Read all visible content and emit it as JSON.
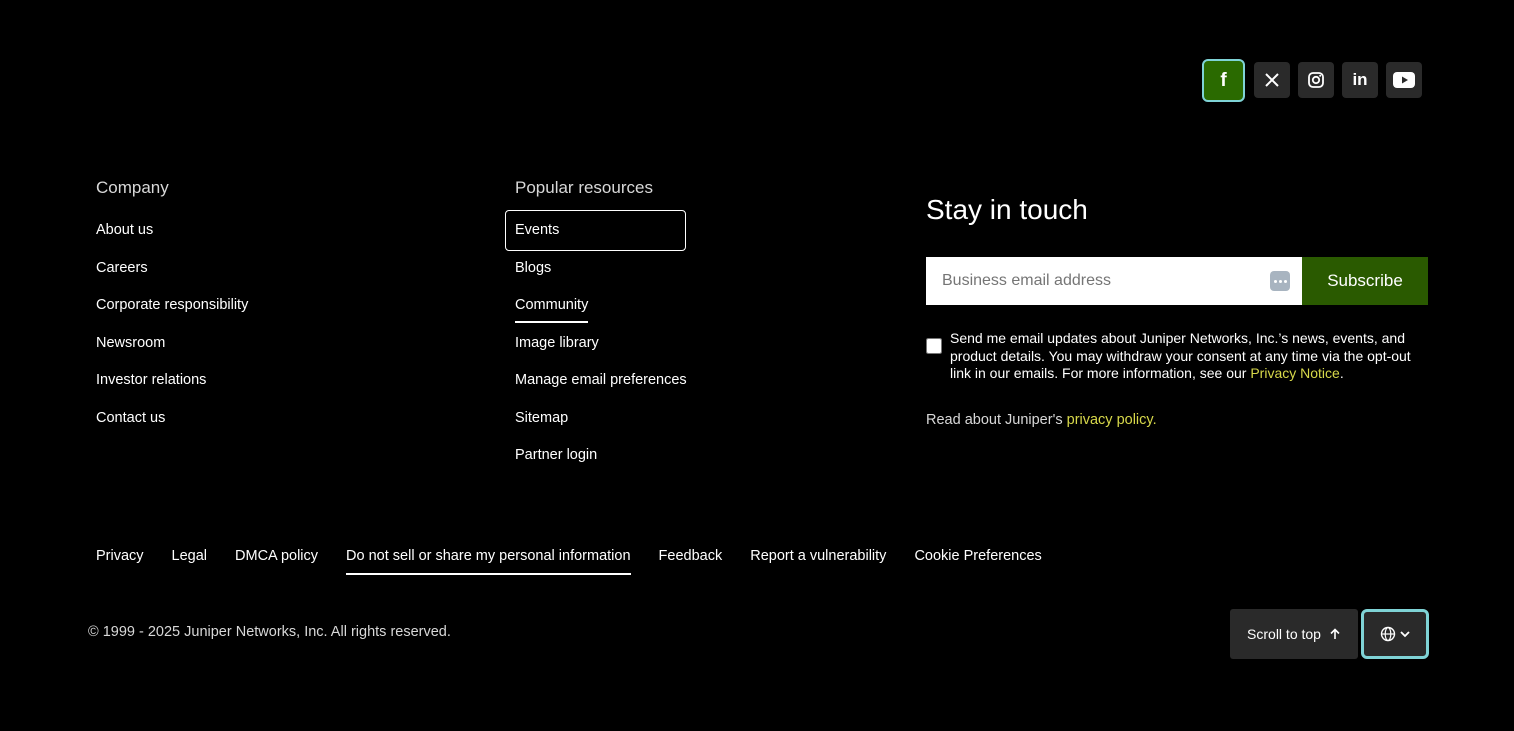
{
  "social": {
    "items": [
      {
        "name": "facebook",
        "glyph": "f"
      },
      {
        "name": "x"
      },
      {
        "name": "instagram"
      },
      {
        "name": "linkedin",
        "glyph": "in"
      },
      {
        "name": "youtube"
      }
    ]
  },
  "company": {
    "heading": "Company",
    "links": [
      "About us",
      "Careers",
      "Corporate responsibility",
      "Newsroom",
      "Investor relations",
      "Contact us"
    ]
  },
  "resources": {
    "heading": "Popular resources",
    "links": [
      "Events",
      "Blogs",
      "Community",
      "Image library",
      "Manage email preferences",
      "Sitemap",
      "Partner login"
    ]
  },
  "stay": {
    "heading": "Stay in touch",
    "email_placeholder": "Business email address",
    "subscribe_label": "Subscribe",
    "consent_text": "Send me email updates about Juniper Networks, Inc.’s news, events, and product details. You may withdraw your consent at any time via the opt-out link in our emails.  For more information, see our ",
    "consent_link": "Privacy Notice",
    "consent_end": ".",
    "privacy_read_text": "Read about Juniper's ",
    "privacy_read_link": "privacy policy."
  },
  "legal": {
    "links": [
      "Privacy",
      "Legal",
      "DMCA policy",
      "Do not sell or share my personal information",
      "Feedback",
      "Report a vulnerability",
      "Cookie Preferences"
    ]
  },
  "copyright": "© 1999 - 2025 Juniper Networks, Inc. All rights reserved.",
  "scroll_top_label": "Scroll to top",
  "colors": {
    "accent_green": "#2a5a00",
    "link_yellow": "#d7d84a",
    "focus_cyan": "#7fd3d6"
  }
}
